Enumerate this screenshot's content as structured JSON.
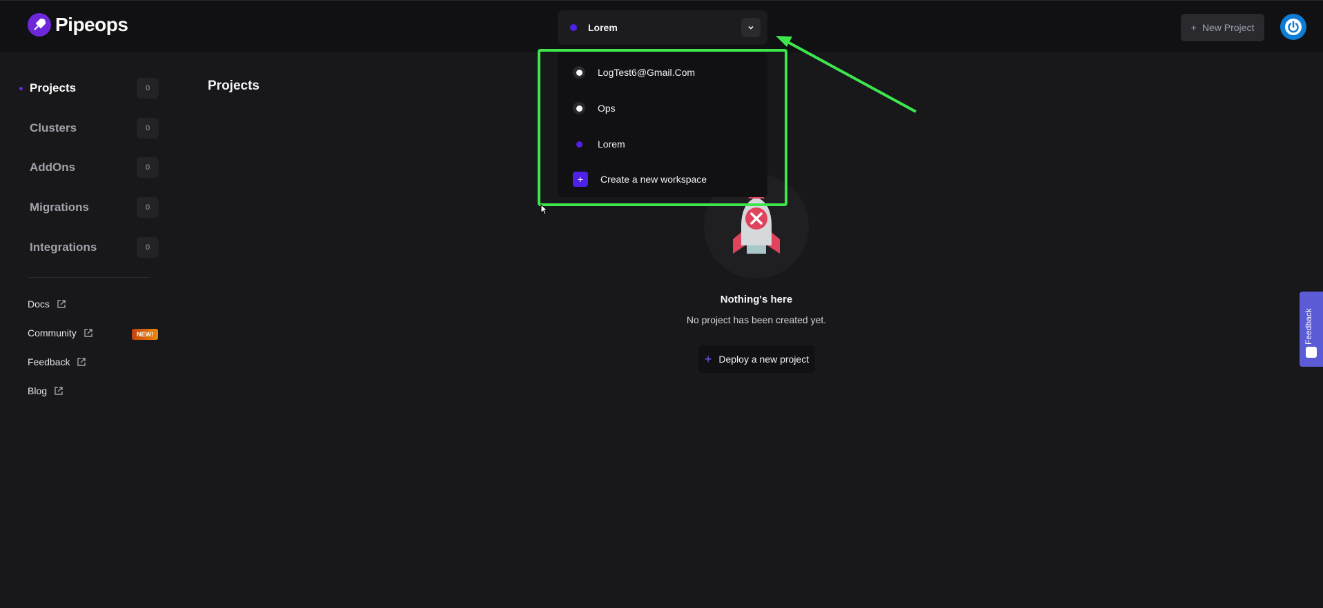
{
  "brand": {
    "name": "Pipeops"
  },
  "workspace_select": {
    "current": "Lorem"
  },
  "header": {
    "new_project_label": "New Project"
  },
  "sidebar": {
    "items": [
      {
        "label": "Projects",
        "count": "0",
        "active": true
      },
      {
        "label": "Clusters",
        "count": "0"
      },
      {
        "label": "AddOns",
        "count": "0"
      },
      {
        "label": "Migrations",
        "count": "0"
      },
      {
        "label": "Integrations",
        "count": "0"
      }
    ],
    "links": [
      {
        "label": "Docs"
      },
      {
        "label": "Community",
        "badge": "NEW!"
      },
      {
        "label": "Feedback"
      },
      {
        "label": "Blog"
      }
    ]
  },
  "main": {
    "title": "Projects",
    "empty_title": "Nothing's here",
    "empty_subtitle": "No project has been created yet.",
    "deploy_label": "Deploy a new project"
  },
  "dropdown": {
    "options": [
      "LogTest6@Gmail.Com",
      "Ops",
      "Lorem"
    ],
    "create_label": "Create a new workspace"
  },
  "feedback_tab": {
    "label": "Feedback"
  },
  "colors": {
    "accent": "#4f21e8",
    "annotation": "#3de64d",
    "power": "#0e7bd4"
  }
}
